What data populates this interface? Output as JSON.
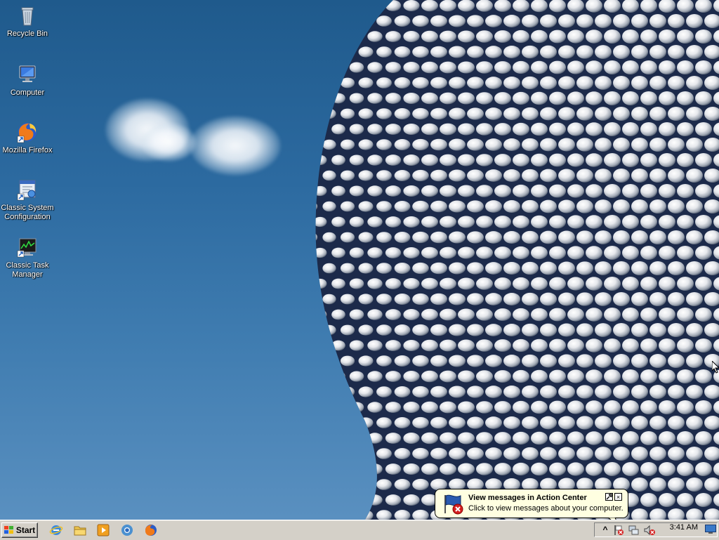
{
  "desktop": {
    "icons": [
      {
        "label": "Recycle Bin",
        "icon": "recycle-bin-icon"
      },
      {
        "label": "Computer",
        "icon": "computer-icon"
      },
      {
        "label": "Mozilla Firefox",
        "icon": "firefox-icon"
      },
      {
        "label": "Classic System Configuration",
        "icon": "system-configuration-icon"
      },
      {
        "label": "Classic Task Manager",
        "icon": "task-manager-icon"
      }
    ]
  },
  "taskbar": {
    "start_label": "Start",
    "quick_launch": [
      {
        "name": "internet-explorer-icon"
      },
      {
        "name": "file-explorer-icon"
      },
      {
        "name": "media-player-icon"
      },
      {
        "name": "chrome-icon"
      },
      {
        "name": "firefox-icon"
      }
    ],
    "tray": {
      "show_hidden_label": "^",
      "clock": "3:41 AM"
    }
  },
  "notification": {
    "title": "View messages in Action Center",
    "text": "Click to view messages about your computer.",
    "options_label": "⚒",
    "close_label": "×"
  },
  "colors": {
    "sky": "#2c6aa0",
    "taskbar": "#d4d0c8",
    "balloon": "#ffffe1"
  }
}
